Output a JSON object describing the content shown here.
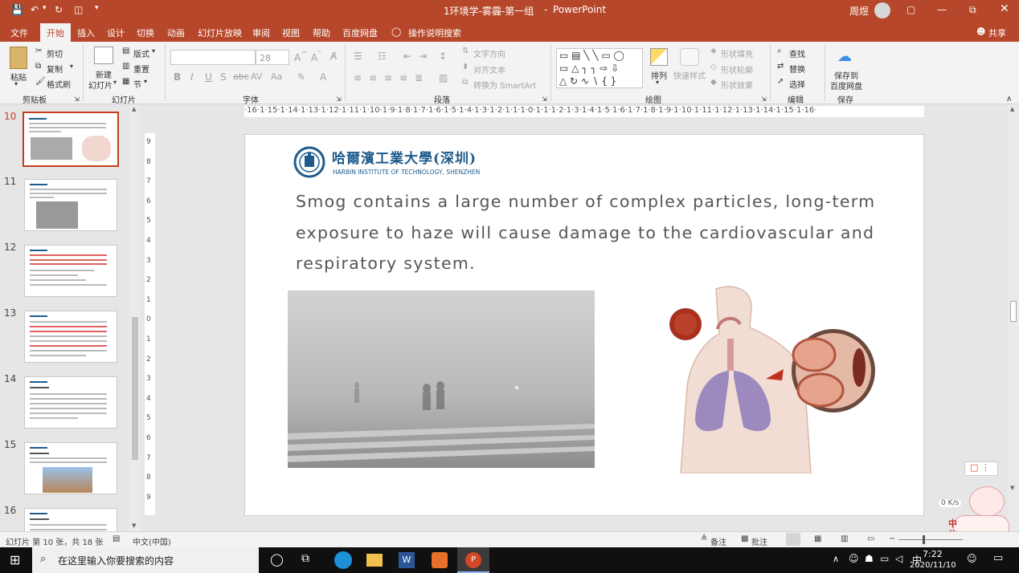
{
  "titlebar": {
    "doc_title": "1环境学-雾霾-第一组",
    "app_name": "PowerPoint",
    "user": "周煜"
  },
  "tabs": [
    "文件",
    "开始",
    "插入",
    "设计",
    "切换",
    "动画",
    "幻灯片放映",
    "审阅",
    "视图",
    "帮助",
    "百度网盘",
    "操作说明搜索"
  ],
  "share_label": "共享",
  "ribbon": {
    "clipboard": {
      "paste": "粘贴",
      "cut": "剪切",
      "copy": "复制",
      "format_painter": "格式刷",
      "group": "剪贴板"
    },
    "slides": {
      "new_slide": "新建",
      "new_slide2": "幻灯片",
      "layout": "版式",
      "reset": "重置",
      "section": "节",
      "group": "幻灯片"
    },
    "font": {
      "size": "28",
      "group": "字体"
    },
    "paragraph": {
      "text_direction": "文字方向",
      "align_text": "对齐文本",
      "smartart": "转换为 SmartArt",
      "group": "段落"
    },
    "drawing": {
      "arrange": "排列",
      "quick_styles": "快速样式",
      "shape_fill": "形状填充",
      "shape_outline": "形状轮廓",
      "shape_effects": "形状效果",
      "group": "绘图"
    },
    "editing": {
      "find": "查找",
      "replace": "替换",
      "select": "选择",
      "group": "编辑"
    },
    "save": {
      "label1": "保存到",
      "label2": "百度网盘",
      "group": "保存"
    }
  },
  "slide_numbers": [
    "10",
    "11",
    "12",
    "13",
    "14",
    "15",
    "16"
  ],
  "ruler_h": "·16·1·15·1·14·1·13·1·12·1·11·1·10·1·9·1·8·1·7·1·6·1·5·1·4·1·3·1·2·1·1·1·0·1·1·1·2·1·3·1·4·1·5·1·6·1·7·1·8·1·9·1·10·1·11·1·12·1·13·1·14·1·15·1·16·",
  "ruler_v": [
    "9",
    "8",
    "7",
    "6",
    "5",
    "4",
    "3",
    "2",
    "1",
    "0",
    "1",
    "2",
    "3",
    "4",
    "5",
    "6",
    "7",
    "8",
    "9"
  ],
  "slide": {
    "logo_cn": "哈爾濱工業大學(深圳)",
    "logo_en": "HARBIN INSTITUTE OF TECHNOLOGY, SHENZHEN",
    "body_line1": "Smog contains a large number of complex particles, long-term",
    "body_line2": "exposure to haze will cause damage to the cardiovascular and",
    "body_line3": "respiratory system."
  },
  "status": {
    "slide_pos": "幻灯片 第 10 张，共 18 张",
    "language": "中文(中国)",
    "notes": "备注",
    "comments": "批注"
  },
  "ime": {
    "label1": "中",
    "label2": "简",
    "speed": "0  K/s"
  },
  "taskbar": {
    "search_placeholder": "在这里输入你要搜索的内容",
    "time": "7:22",
    "date": "2020/11/10"
  },
  "colors": {
    "accent": "#b7472a",
    "selected": "#c43e1c",
    "logo_blue": "#1f5b8c"
  }
}
